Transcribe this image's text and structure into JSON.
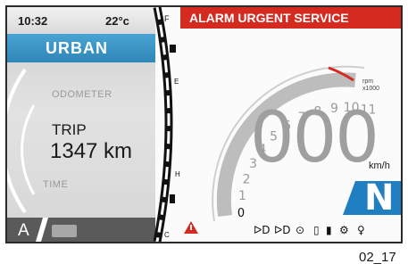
{
  "status": {
    "time": "10:32",
    "temperature": "22°c"
  },
  "riding_mode": "URBAN",
  "odometer": {
    "label": "ODOMETER"
  },
  "trip": {
    "label": "TRIP",
    "value": "1347 km"
  },
  "time_label": "TIME",
  "bottom": {
    "gear_mode": "A"
  },
  "fuel": {
    "full_label": "F",
    "empty_label": "E",
    "h_label": "H",
    "c_label": "C"
  },
  "alarm": {
    "text": "ALARM URGENT SERVICE"
  },
  "tachometer": {
    "ticks": [
      "0",
      "1",
      "2",
      "3",
      "4",
      "5",
      "6",
      "7",
      "8",
      "9",
      "10",
      "11"
    ],
    "unit_line1": "rpm",
    "unit_line2": "x1000"
  },
  "speed": {
    "value": "000",
    "unit": "km/h"
  },
  "gear": "N",
  "indicators": [
    "low-beam-icon",
    "fog-light-icon",
    "service-icon",
    "battery-icon",
    "oil-icon",
    "wrench-icon",
    "key-icon"
  ],
  "caption": "02_17",
  "colors": {
    "alarm": "#d42a1f",
    "mode_band": "#3a93c6",
    "gear_bg": "#1f7fc0",
    "redline": "#d42a1f"
  }
}
